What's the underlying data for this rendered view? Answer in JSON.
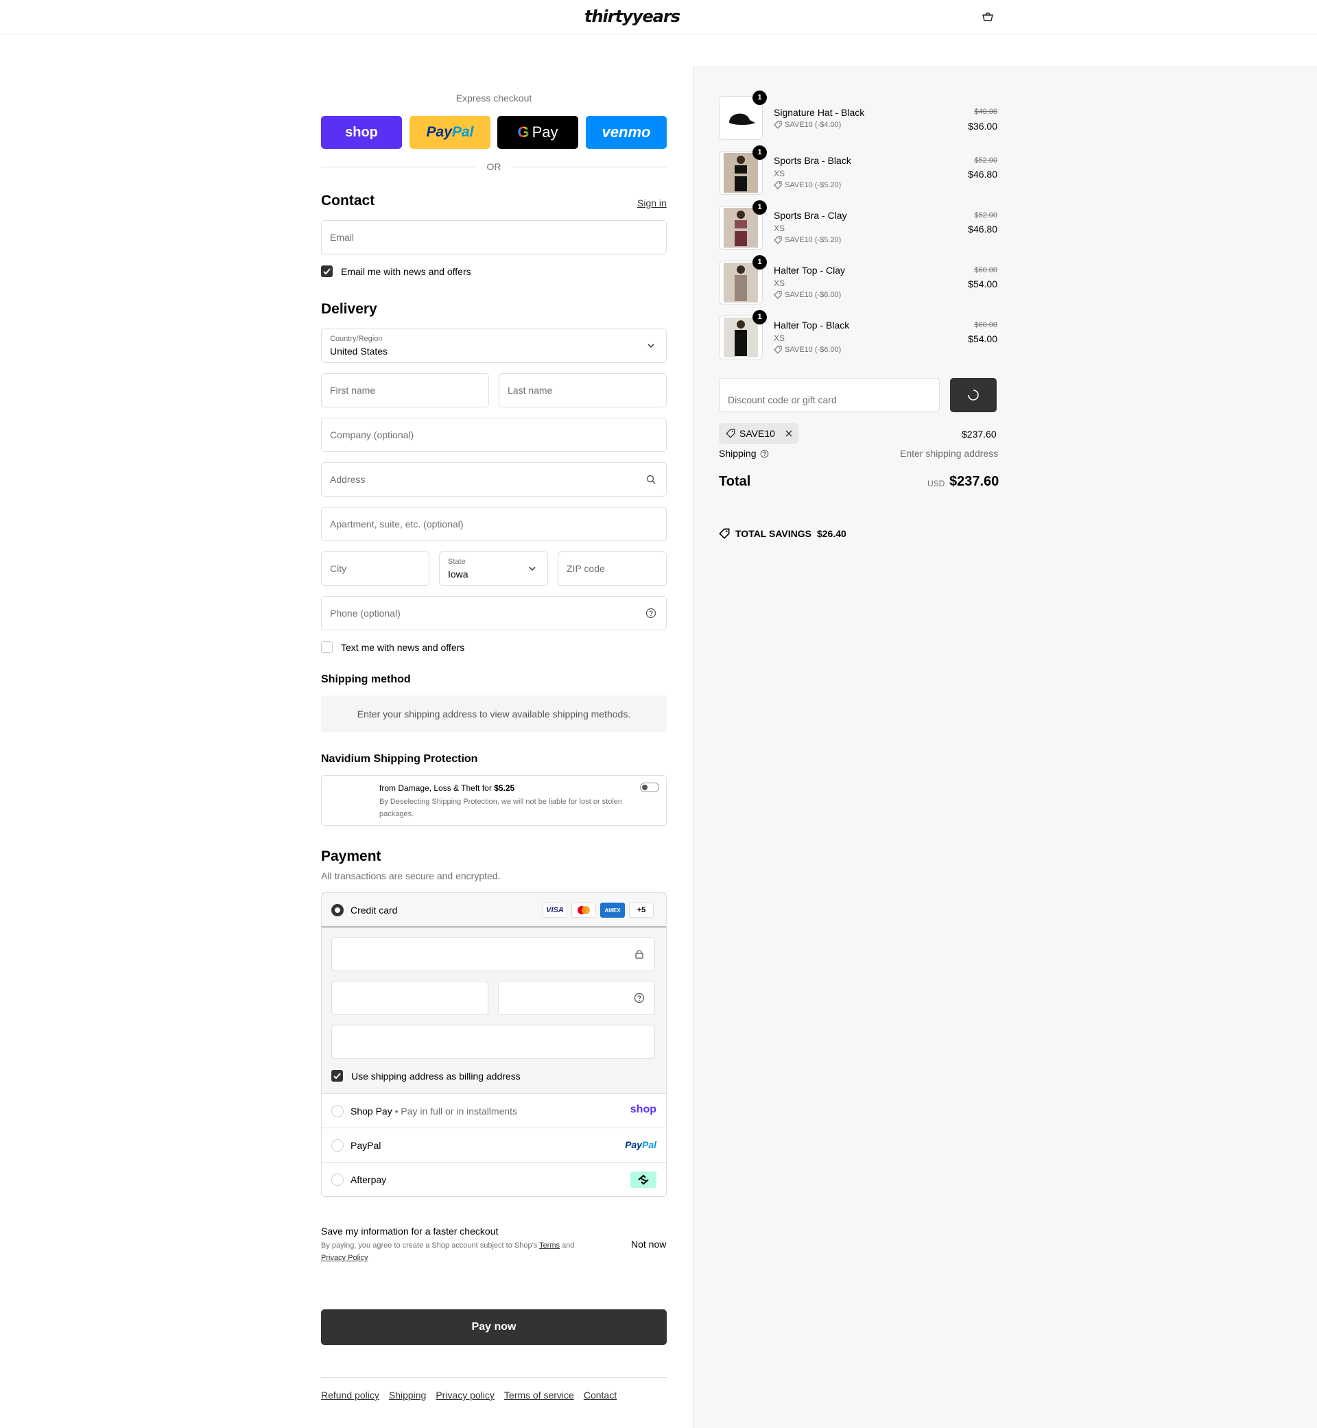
{
  "header": {
    "logo": "thirtyyears",
    "cart_icon": "cart-icon"
  },
  "express": {
    "label": "Express checkout",
    "buttons": {
      "shop": "shop",
      "paypal_a": "Pay",
      "paypal_b": "Pal",
      "gpay_g": "G",
      "gpay_text": "Pay",
      "venmo": "venmo"
    },
    "or": "OR"
  },
  "contact": {
    "title": "Contact",
    "sign_in": "Sign in",
    "email_placeholder": "Email",
    "newsletter_label": "Email me with news and offers",
    "newsletter_checked": true
  },
  "delivery": {
    "title": "Delivery",
    "country_label": "Country/Region",
    "country_value": "United States",
    "first_name": "First name",
    "last_name": "Last name",
    "company": "Company (optional)",
    "address": "Address",
    "apartment": "Apartment, suite, etc. (optional)",
    "city": "City",
    "state_label": "State",
    "state_value": "Iowa",
    "zip": "ZIP code",
    "phone": "Phone (optional)",
    "sms_label": "Text me with news and offers",
    "sms_checked": false
  },
  "shipping_method": {
    "title": "Shipping method",
    "notice": "Enter your shipping address to view available shipping methods."
  },
  "protection": {
    "title": "Navidium Shipping Protection",
    "main": "from Damage, Loss & Theft for",
    "price": "$5.25",
    "sub": "By Deselecting Shipping Protection, we will not be liable for lost or stolen packages."
  },
  "payment": {
    "title": "Payment",
    "subtitle": "All transactions are secure and encrypted.",
    "credit_card": "Credit card",
    "brands": {
      "visa": "VISA",
      "amex": "AMEX",
      "more": "+5"
    },
    "billing_label": "Use shipping address as billing address",
    "billing_checked": true,
    "shop_pay": "Shop Pay",
    "shop_pay_sub": "Pay in full or in installments",
    "shop_pay_logo": "shop",
    "paypal": "PayPal",
    "paypal_logo_a": "Pay",
    "paypal_logo_b": "Pal",
    "afterpay": "Afterpay"
  },
  "save_info": {
    "title": "Save my information for a faster checkout",
    "sub_a": "By paying, you agree to create a Shop account subject to Shop's ",
    "terms": "Terms",
    "sub_b": " and ",
    "privacy": "Privacy Policy",
    "not_now": "Not now"
  },
  "pay_now": "Pay now",
  "footer": [
    "Refund policy",
    "Shipping",
    "Privacy policy",
    "Terms of service",
    "Contact"
  ],
  "order": {
    "items": [
      {
        "name": "Signature Hat - Black",
        "variant": "",
        "discount": "SAVE10 (-$4.00)",
        "original": "$40.00",
        "price": "$36.00",
        "qty": "1"
      },
      {
        "name": "Sports Bra - Black",
        "variant": "XS",
        "discount": "SAVE10 (-$5.20)",
        "original": "$52.00",
        "price": "$46.80",
        "qty": "1"
      },
      {
        "name": "Sports Bra - Clay",
        "variant": "XS",
        "discount": "SAVE10 (-$5.20)",
        "original": "$52.00",
        "price": "$46.80",
        "qty": "1"
      },
      {
        "name": "Halter Top - Clay",
        "variant": "XS",
        "discount": "SAVE10 (-$6.00)",
        "original": "$60.00",
        "price": "$54.00",
        "qty": "1"
      },
      {
        "name": "Halter Top - Black",
        "variant": "XS",
        "discount": "SAVE10 (-$6.00)",
        "original": "$60.00",
        "price": "$54.00",
        "qty": "1"
      }
    ],
    "discount_placeholder": "Discount code or gift card",
    "applied_code": "SAVE10",
    "subtotal": "$237.60",
    "shipping_label": "Shipping",
    "shipping_value": "Enter shipping address",
    "total_label": "Total",
    "currency": "USD",
    "total": "$237.60",
    "savings_label": "TOTAL SAVINGS",
    "savings_value": "$26.40"
  },
  "colors": {
    "accent": "#333333",
    "shop": "#5a31f4",
    "paypal": "#ffc439",
    "venmo": "#008cff",
    "afterpay": "#b2fce4"
  }
}
